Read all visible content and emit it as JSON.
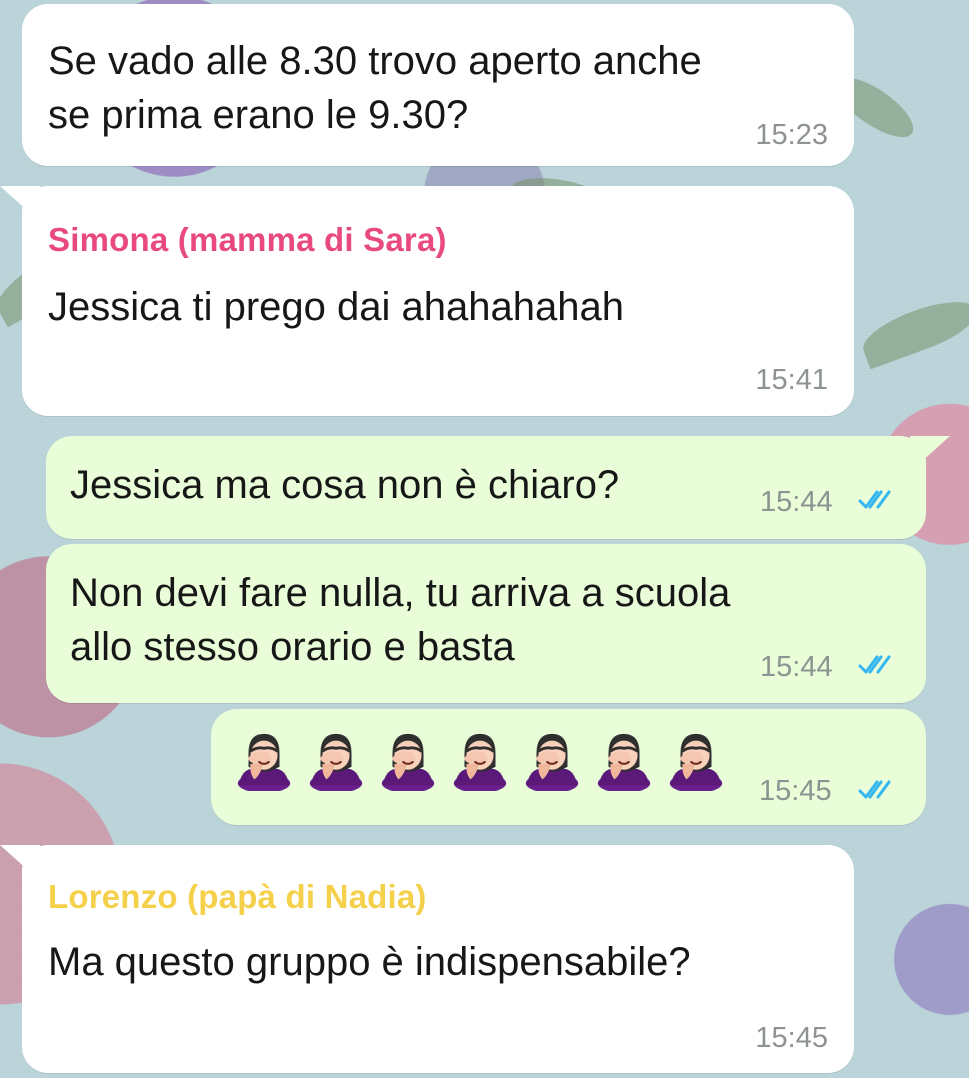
{
  "messages": [
    {
      "direction": "incoming",
      "text": "Se vado alle 8.30 trovo aperto anche\nse prima erano le 9.30?",
      "time": "15:23"
    },
    {
      "direction": "incoming",
      "sender": "Simona (mamma di Sara)",
      "sender_color": "#e84a7f",
      "text": "Jessica ti prego dai ahahahahah",
      "time": "15:41"
    },
    {
      "direction": "outgoing",
      "text": "Jessica ma cosa non è chiaro?",
      "time": "15:44",
      "status": "read"
    },
    {
      "direction": "outgoing",
      "text": "Non devi fare nulla, tu arriva a scuola\nallo stesso orario e basta",
      "time": "15:44",
      "status": "read"
    },
    {
      "direction": "outgoing",
      "emoji_name": "woman-facepalming-icon",
      "emoji_count": 7,
      "time": "15:45",
      "status": "read"
    },
    {
      "direction": "incoming",
      "sender": "Lorenzo (papà di Nadia)",
      "sender_color": "#f5d04a",
      "text": "Ma questo gruppo è indispensabile?",
      "time": "15:45"
    }
  ],
  "colors": {
    "incoming_bubble": "#ffffff",
    "outgoing_bubble": "#e8fdd8",
    "read_tick": "#34b7f1",
    "time_text": "#8c9390"
  }
}
